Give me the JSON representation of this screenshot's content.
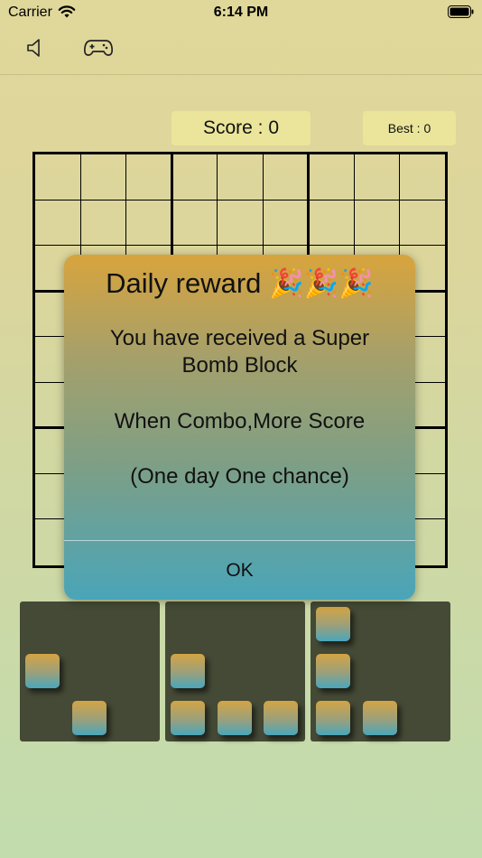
{
  "status_bar": {
    "carrier": "Carrier",
    "time": "6:14 PM"
  },
  "toolbar": {
    "sound_icon": "speaker-icon",
    "game_icon": "gamepad-icon"
  },
  "scoreboard": {
    "score_label": "Score : 0",
    "best_label": "Best : 0"
  },
  "board": {
    "rows": 9,
    "columns": 9
  },
  "dialog": {
    "title": "Daily reward 🎉🎉🎉",
    "message_line1": "You have received a Super",
    "message_line2": "Bomb Block",
    "message_line3": "When Combo,More Score",
    "message_line4": "(One day One chance)",
    "ok_label": "OK"
  },
  "pieces": [
    {
      "name": "piece-1",
      "blocks": [
        [
          0,
          1
        ],
        [
          1,
          2
        ]
      ]
    },
    {
      "name": "piece-2",
      "blocks": [
        [
          0,
          1
        ],
        [
          0,
          2
        ],
        [
          1,
          2
        ],
        [
          2,
          2
        ]
      ]
    },
    {
      "name": "piece-3",
      "blocks": [
        [
          0,
          0
        ],
        [
          0,
          1
        ],
        [
          0,
          2
        ],
        [
          1,
          2
        ]
      ]
    }
  ],
  "colors": {
    "block_top": "#d4a444",
    "block_bottom": "#4aa6bb",
    "slot_bg": "#454a36",
    "score_bg": "#eae59a"
  }
}
